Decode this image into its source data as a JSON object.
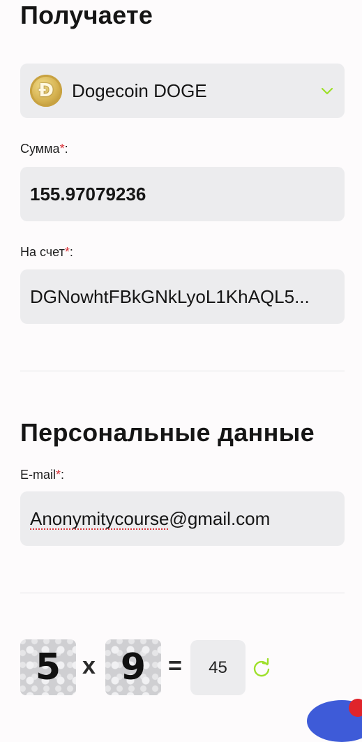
{
  "receive": {
    "heading": "Получаете",
    "currency": {
      "coin_icon": "dogecoin-icon",
      "label": "Dogecoin DOGE",
      "chevron_color": "#9ee02a"
    },
    "amount": {
      "label": "Сумма",
      "required_mark": "*",
      "colon": ":",
      "value": "155.97079236"
    },
    "account": {
      "label": "На счет",
      "required_mark": "*",
      "colon": ":",
      "value": "DGNowhtFBkGNkLyoL1KhAQL5..."
    }
  },
  "personal": {
    "heading": "Персональные данные",
    "email": {
      "label": "E-mail",
      "required_mark": "*",
      "colon": ":",
      "value_underlined": "Anonymitycourse",
      "value_rest": "@gmail.com"
    }
  },
  "captcha": {
    "first": "5",
    "operator": "x",
    "second": "9",
    "equals": "=",
    "answer": "45",
    "refresh_icon": "refresh-icon",
    "refresh_color": "#9ee02a"
  },
  "colors": {
    "required": "#d9333a",
    "field_bg": "#ececee",
    "chat_button": "#3e5bd8",
    "notification": "#e0242b"
  }
}
